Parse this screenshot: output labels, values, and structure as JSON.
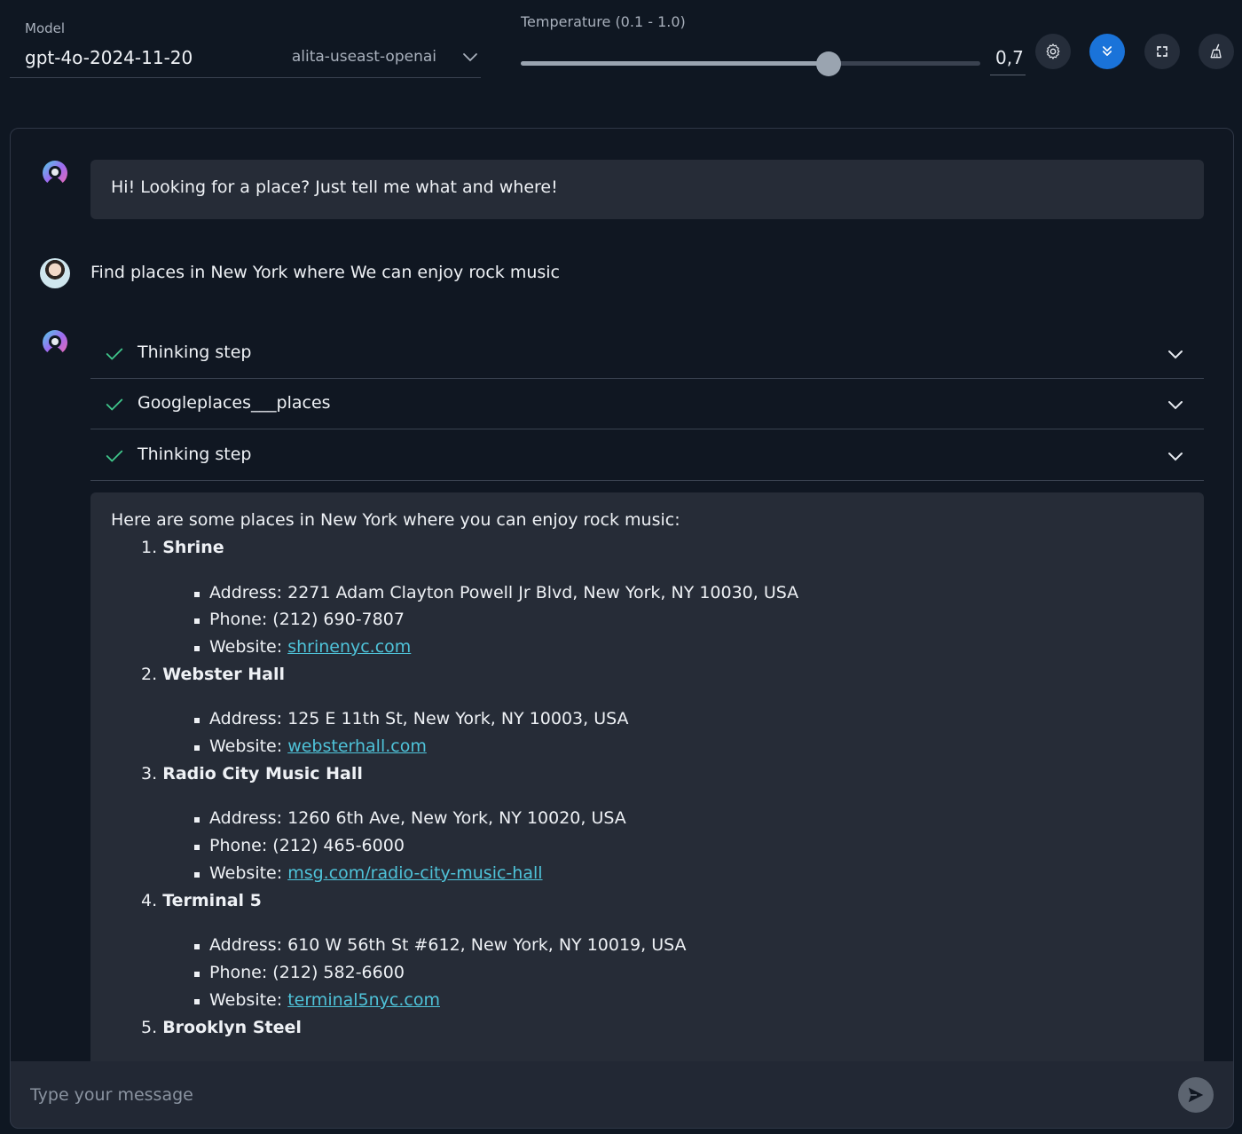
{
  "toolbar": {
    "model_label": "Model",
    "model_value": "gpt-4o-2024-11-20",
    "model_provider": "alita-useast-openai",
    "temperature_label": "Temperature (0.1 - 1.0)",
    "temperature_value": "0,7",
    "temperature_fraction": 0.67,
    "icons": [
      "gear-icon",
      "double-chevron-down-icon",
      "fullscreen-icon",
      "broom-icon"
    ],
    "accent_color": "#1a73d9"
  },
  "chat": {
    "greeting": "Hi! Looking for a place? Just tell me what and where!",
    "user_message": "Find places in New York where We can enjoy rock music",
    "steps": [
      {
        "label": "Thinking step"
      },
      {
        "label": "Googleplaces___places"
      },
      {
        "label": "Thinking step"
      }
    ],
    "answer": {
      "intro": "Here are some places in New York where you can enjoy rock music:",
      "places": [
        {
          "number": "1.",
          "name": "Shrine",
          "address": "Address: 2271 Adam Clayton Powell Jr Blvd, New York, NY 10030, USA",
          "phone": "Phone: (212) 690-7807",
          "website_label": "Website: ",
          "website": "shrinenyc.com"
        },
        {
          "number": "2.",
          "name": "Webster Hall",
          "address": "Address: 125 E 11th St, New York, NY 10003, USA",
          "website_label": "Website: ",
          "website": "websterhall.com"
        },
        {
          "number": "3.",
          "name": "Radio City Music Hall",
          "address": "Address: 1260 6th Ave, New York, NY 10020, USA",
          "phone": "Phone: (212) 465-6000",
          "website_label": "Website: ",
          "website": "msg.com/radio-city-music-hall"
        },
        {
          "number": "4.",
          "name": "Terminal 5",
          "address": "Address: 610 W 56th St #612, New York, NY 10019, USA",
          "phone": "Phone: (212) 582-6600",
          "website_label": "Website: ",
          "website": "terminal5nyc.com"
        },
        {
          "number": "5.",
          "name": "Brooklyn Steel"
        }
      ]
    }
  },
  "input": {
    "placeholder": "Type your message"
  }
}
